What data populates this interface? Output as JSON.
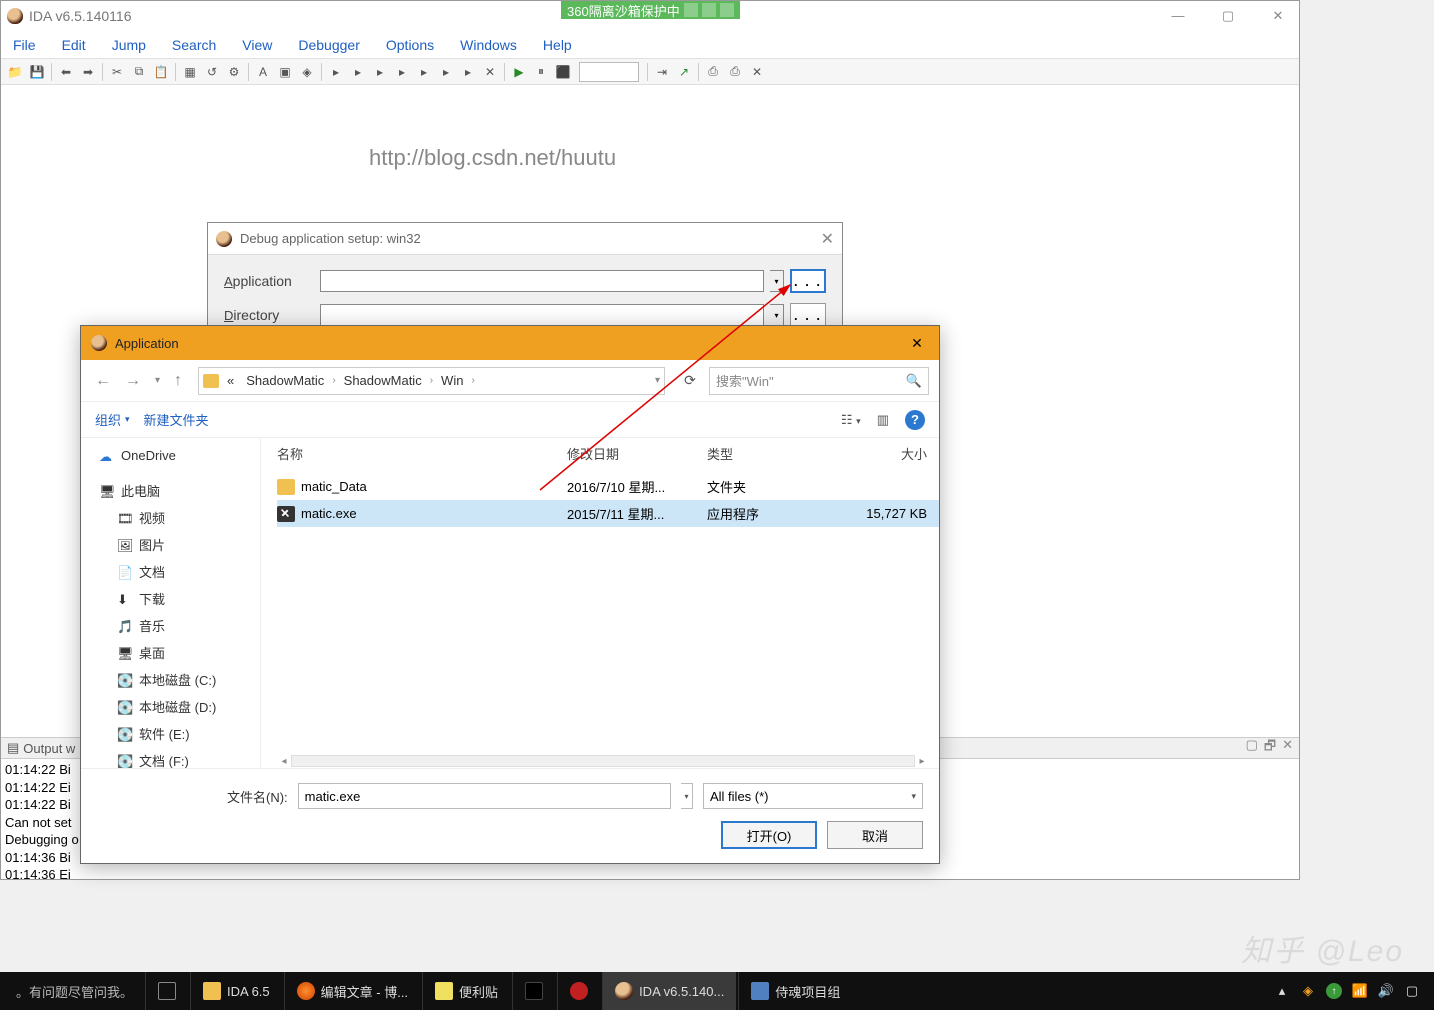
{
  "window": {
    "title": "IDA v6.5.140116",
    "sandboxTag": "360隔离沙箱保护中",
    "watermarkUrl": "http://blog.csdn.net/huutu"
  },
  "menu": {
    "file": "File",
    "edit": "Edit",
    "jump": "Jump",
    "search": "Search",
    "view": "View",
    "debugger": "Debugger",
    "options": "Options",
    "windows": "Windows",
    "help": "Help"
  },
  "outputPanel": {
    "title": "Output w",
    "lines": [
      "01:14:22 Bi",
      "01:14:22 Ei",
      "01:14:22 Bi",
      "Can not set",
      "Debugging o",
      "01:14:36 Bi",
      "01:14:36 Ei"
    ]
  },
  "debugSetup": {
    "title": "Debug application setup: win32",
    "applicationLabel": "Application",
    "directoryLabel": "Directory",
    "browse": ". . ."
  },
  "fileDialog": {
    "title": "Application",
    "breadcrumb": {
      "lead": "«",
      "p1": "ShadowMatic",
      "p2": "ShadowMatic",
      "p3": "Win"
    },
    "searchPlaceholder": "搜索\"Win\"",
    "organize": "组织",
    "newFolder": "新建文件夹",
    "sidebar": {
      "onedrive": "OneDrive",
      "thisPC": "此电脑",
      "video": "视频",
      "pictures": "图片",
      "documents": "文档",
      "downloads": "下载",
      "music": "音乐",
      "desktop": "桌面",
      "diskC": "本地磁盘 (C:)",
      "diskD": "本地磁盘 (D:)",
      "diskE": "软件 (E:)",
      "diskF": "文档 (F:)"
    },
    "columns": {
      "name": "名称",
      "date": "修改日期",
      "type": "类型",
      "size": "大小"
    },
    "rows": [
      {
        "name": "matic_Data",
        "date": "2016/7/10 星期...",
        "type": "文件夹",
        "size": "",
        "kind": "folder"
      },
      {
        "name": "matic.exe",
        "date": "2015/7/11 星期...",
        "type": "应用程序",
        "size": "15,727 KB",
        "kind": "exe",
        "selected": true
      }
    ],
    "filenameLabel": "文件名(N):",
    "filenameValue": "matic.exe",
    "filter": "All files (*)",
    "open": "打开(O)",
    "cancel": "取消"
  },
  "taskbar": {
    "hint": "。有问题尽管问我。",
    "items": [
      {
        "label": "",
        "icon": "taskview"
      },
      {
        "label": "IDA 6.5",
        "icon": "folder"
      },
      {
        "label": "编辑文章 - 博...",
        "icon": "firefox"
      },
      {
        "label": "便利贴",
        "icon": "note"
      },
      {
        "label": "",
        "icon": "terminal"
      },
      {
        "label": "",
        "icon": "red"
      },
      {
        "label": "IDA v6.5.140...",
        "icon": "ida",
        "active": true
      },
      {
        "label": "侍魂项目组",
        "icon": "people"
      }
    ]
  },
  "watermark": "知乎 @Leo"
}
